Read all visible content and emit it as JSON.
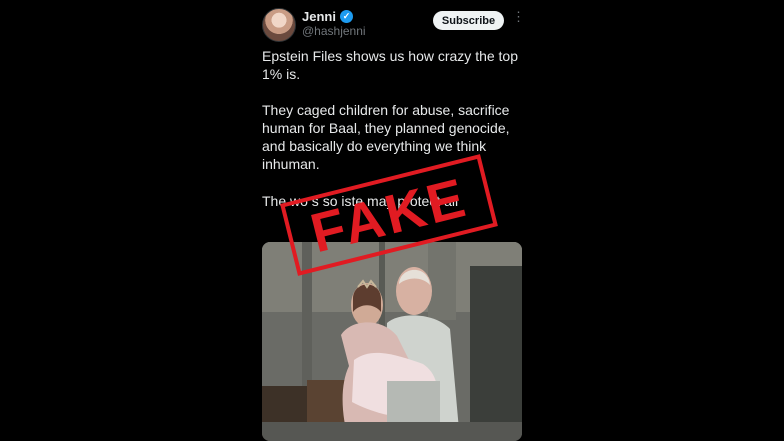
{
  "tweet": {
    "display_name": "Jenni",
    "handle": "@hashjenni",
    "subscribe_label": "Subscribe",
    "verified_badge": "verified-badge",
    "more_icon": "more-icon",
    "paragraph_1": "Epstein Files shows us how crazy the top 1% is.",
    "paragraph_2": "They caged children for abuse, sacrifice human for Baal, they planned genocide, and basically do everything we think inhuman.",
    "paragraph_3_visible": "The wo      s so    iste       may           protect      all"
  },
  "overlay": {
    "stamp_text": "FAKE"
  },
  "colors": {
    "background": "#000000",
    "text": "#e7e9ea",
    "muted": "#71767b",
    "verified": "#1d9bf0",
    "stamp_red": "#e11b22"
  }
}
